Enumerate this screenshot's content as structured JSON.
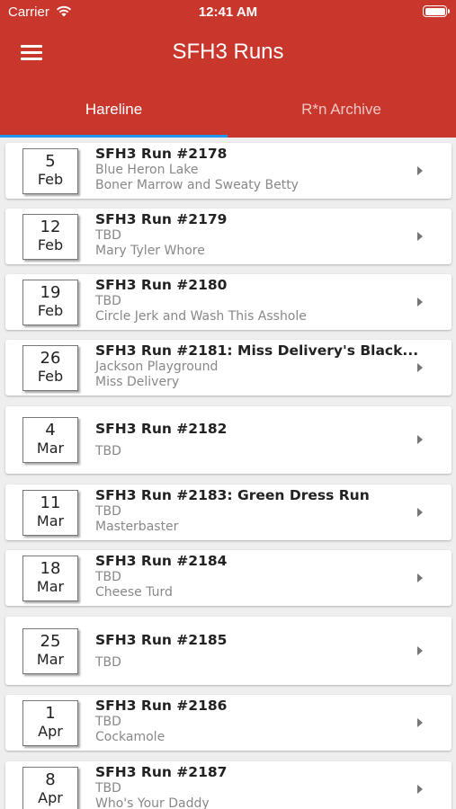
{
  "status_bar": {
    "carrier": "Carrier",
    "time": "12:41 AM"
  },
  "app_bar": {
    "title": "SFH3 Runs",
    "menu_icon": "hamburger-menu-icon"
  },
  "tabs": [
    {
      "label": "Hareline",
      "selected": true
    },
    {
      "label": "R*n Archive",
      "selected": false
    }
  ],
  "colors": {
    "primary": "#c8362c",
    "tab_indicator": "#2196f3",
    "secondary_text": "#888888"
  },
  "runs": [
    {
      "day": "5",
      "month": "Feb",
      "title": "SFH3 Run #2178",
      "line1": "Blue Heron Lake",
      "line2": "Boner Marrow and Sweaty Betty"
    },
    {
      "day": "12",
      "month": "Feb",
      "title": "SFH3 Run #2179",
      "line1": "TBD",
      "line2": "Mary Tyler Whore"
    },
    {
      "day": "19",
      "month": "Feb",
      "title": "SFH3 Run #2180",
      "line1": "TBD",
      "line2": "Circle Jerk and Wash This Asshole"
    },
    {
      "day": "26",
      "month": "Feb",
      "title": "SFH3 Run #2181: Miss Delivery's Black...",
      "line1": "Jackson Playground",
      "line2": "Miss Delivery"
    },
    {
      "day": "4",
      "month": "Mar",
      "title": "SFH3 Run #2182",
      "line1": "TBD",
      "line2": ""
    },
    {
      "day": "11",
      "month": "Mar",
      "title": "SFH3 Run #2183: Green Dress Run",
      "line1": "TBD",
      "line2": "Masterbaster"
    },
    {
      "day": "18",
      "month": "Mar",
      "title": "SFH3 Run #2184",
      "line1": "TBD",
      "line2": "Cheese Turd"
    },
    {
      "day": "25",
      "month": "Mar",
      "title": "SFH3 Run #2185",
      "line1": "TBD",
      "line2": ""
    },
    {
      "day": "1",
      "month": "Apr",
      "title": "SFH3 Run #2186",
      "line1": "TBD",
      "line2": "Cockamole"
    },
    {
      "day": "8",
      "month": "Apr",
      "title": "SFH3 Run #2187",
      "line1": "TBD",
      "line2": "Who's Your Daddy"
    }
  ]
}
